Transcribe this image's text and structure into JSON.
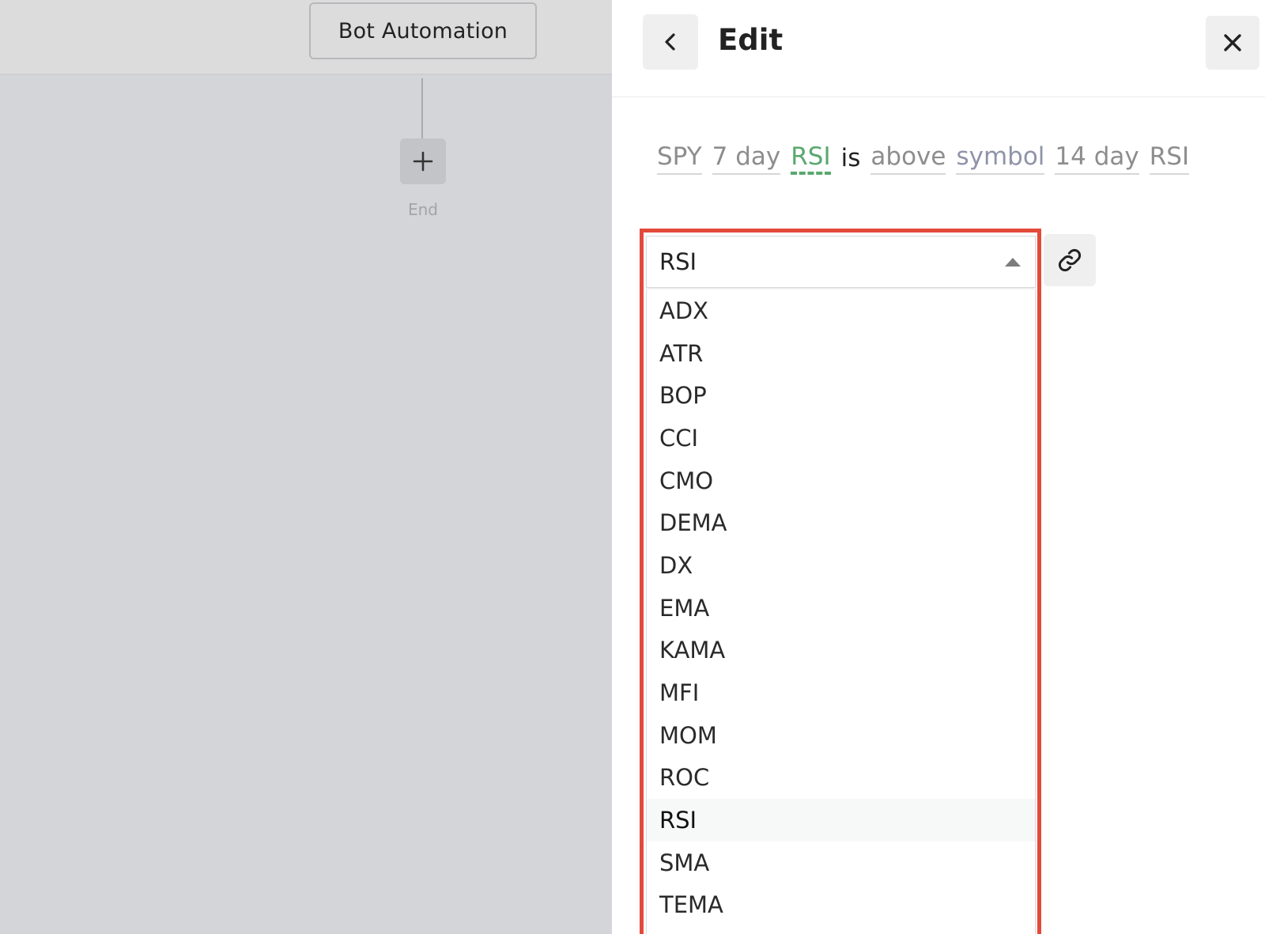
{
  "canvas": {
    "node_label": "Bot Automation",
    "end_label": "End"
  },
  "panel": {
    "title": "Edit"
  },
  "sentence": {
    "tokens": [
      "SPY",
      "7 day",
      "RSI",
      "is",
      "above",
      "symbol",
      "14 day",
      "RSI"
    ]
  },
  "dropdown": {
    "selected": "RSI",
    "options": [
      "ADX",
      "ATR",
      "BOP",
      "CCI",
      "CMO",
      "DEMA",
      "DX",
      "EMA",
      "KAMA",
      "MFI",
      "MOM",
      "ROC",
      "RSI",
      "SMA",
      "TEMA"
    ],
    "highlighted_option": "RSI"
  },
  "icons": {
    "back": "chevron-left-icon",
    "close": "close-icon",
    "add": "plus-icon",
    "link": "link-icon",
    "dropdown_arrow": "caret-up-icon"
  },
  "colors": {
    "active_token": "#59a86e",
    "highlight_frame": "#e34a3b",
    "symbol_token": "#8f94a8"
  }
}
